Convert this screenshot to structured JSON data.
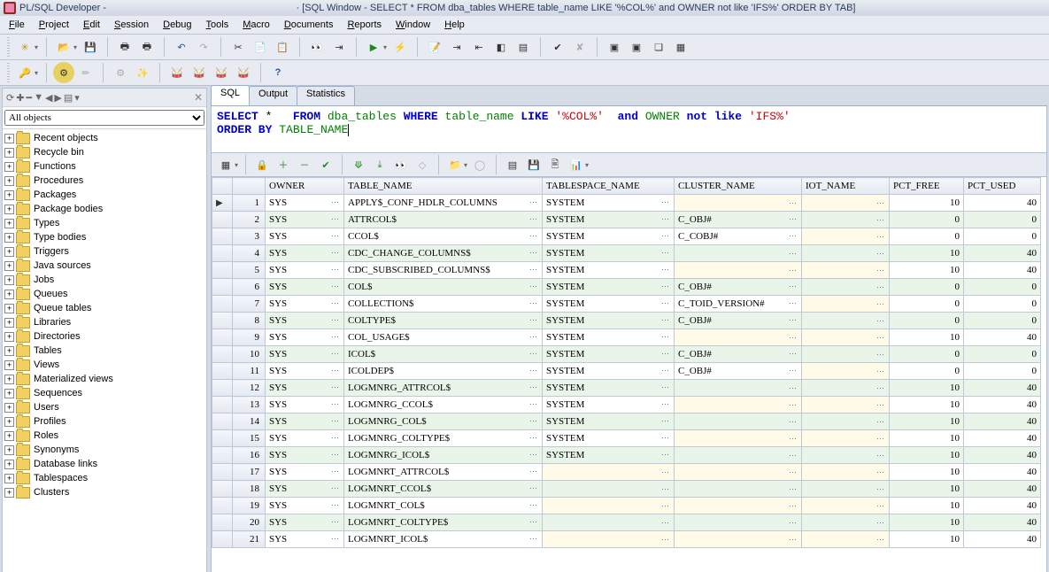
{
  "title": {
    "app": "PL/SQL Developer -",
    "doc": "· [SQL Window - SELECT * FROM dba_tables WHERE table_name LIKE '%COL%' and OWNER not like 'IFS%' ORDER BY TAB]"
  },
  "menu": [
    "File",
    "Project",
    "Edit",
    "Session",
    "Debug",
    "Tools",
    "Macro",
    "Documents",
    "Reports",
    "Window",
    "Help"
  ],
  "sidebar": {
    "filter_selected": "All objects",
    "items": [
      "Recent objects",
      "Recycle bin",
      "Functions",
      "Procedures",
      "Packages",
      "Package bodies",
      "Types",
      "Type bodies",
      "Triggers",
      "Java sources",
      "Jobs",
      "Queues",
      "Queue tables",
      "Libraries",
      "Directories",
      "Tables",
      "Views",
      "Materialized views",
      "Sequences",
      "Users",
      "Profiles",
      "Roles",
      "Synonyms",
      "Database links",
      "Tablespaces",
      "Clusters"
    ]
  },
  "editor": {
    "tabs": [
      "SQL",
      "Output",
      "Statistics"
    ],
    "active_tab": 0,
    "sql_line1": {
      "pre": "SELECT *   FROM ",
      "tbl": "dba_tables",
      "mid1": " WHERE ",
      "col": "table_name",
      "mid2": " LIKE ",
      "str1": "'%COL%'",
      "mid3": "  and ",
      "own": "OWNER",
      "mid4": " not like ",
      "str2": "'IFS%'"
    },
    "sql_line2": {
      "pre": "ORDER BY ",
      "col": "TABLE_NAME"
    }
  },
  "grid": {
    "columns": [
      "OWNER",
      "TABLE_NAME",
      "TABLESPACE_NAME",
      "CLUSTER_NAME",
      "IOT_NAME",
      "PCT_FREE",
      "PCT_USED"
    ],
    "rows": [
      {
        "n": 1,
        "cur": true,
        "owner": "SYS",
        "tname": "APPLY$_CONF_HDLR_COLUMNS",
        "ts": "SYSTEM",
        "cluster": "",
        "iot": "",
        "free": 10,
        "used": 40
      },
      {
        "n": 2,
        "owner": "SYS",
        "tname": "ATTRCOL$",
        "ts": "SYSTEM",
        "cluster": "C_OBJ#",
        "iot": "",
        "free": 0,
        "used": 0
      },
      {
        "n": 3,
        "owner": "SYS",
        "tname": "CCOL$",
        "ts": "SYSTEM",
        "cluster": "C_COBJ#",
        "iot": "",
        "free": 0,
        "used": 0
      },
      {
        "n": 4,
        "owner": "SYS",
        "tname": "CDC_CHANGE_COLUMNS$",
        "ts": "SYSTEM",
        "cluster": "",
        "iot": "",
        "free": 10,
        "used": 40
      },
      {
        "n": 5,
        "owner": "SYS",
        "tname": "CDC_SUBSCRIBED_COLUMNS$",
        "ts": "SYSTEM",
        "cluster": "",
        "iot": "",
        "free": 10,
        "used": 40
      },
      {
        "n": 6,
        "owner": "SYS",
        "tname": "COL$",
        "ts": "SYSTEM",
        "cluster": "C_OBJ#",
        "iot": "",
        "free": 0,
        "used": 0
      },
      {
        "n": 7,
        "owner": "SYS",
        "tname": "COLLECTION$",
        "ts": "SYSTEM",
        "cluster": "C_TOID_VERSION#",
        "iot": "",
        "free": 0,
        "used": 0
      },
      {
        "n": 8,
        "owner": "SYS",
        "tname": "COLTYPE$",
        "ts": "SYSTEM",
        "cluster": "C_OBJ#",
        "iot": "",
        "free": 0,
        "used": 0
      },
      {
        "n": 9,
        "owner": "SYS",
        "tname": "COL_USAGE$",
        "ts": "SYSTEM",
        "cluster": "",
        "iot": "",
        "free": 10,
        "used": 40
      },
      {
        "n": 10,
        "owner": "SYS",
        "tname": "ICOL$",
        "ts": "SYSTEM",
        "cluster": "C_OBJ#",
        "iot": "",
        "free": 0,
        "used": 0
      },
      {
        "n": 11,
        "owner": "SYS",
        "tname": "ICOLDEP$",
        "ts": "SYSTEM",
        "cluster": "C_OBJ#",
        "iot": "",
        "free": 0,
        "used": 0
      },
      {
        "n": 12,
        "owner": "SYS",
        "tname": "LOGMNRG_ATTRCOL$",
        "ts": "SYSTEM",
        "cluster": "",
        "iot": "",
        "free": 10,
        "used": 40
      },
      {
        "n": 13,
        "owner": "SYS",
        "tname": "LOGMNRG_CCOL$",
        "ts": "SYSTEM",
        "cluster": "",
        "iot": "",
        "free": 10,
        "used": 40
      },
      {
        "n": 14,
        "owner": "SYS",
        "tname": "LOGMNRG_COL$",
        "ts": "SYSTEM",
        "cluster": "",
        "iot": "",
        "free": 10,
        "used": 40
      },
      {
        "n": 15,
        "owner": "SYS",
        "tname": "LOGMNRG_COLTYPE$",
        "ts": "SYSTEM",
        "cluster": "",
        "iot": "",
        "free": 10,
        "used": 40
      },
      {
        "n": 16,
        "owner": "SYS",
        "tname": "LOGMNRG_ICOL$",
        "ts": "SYSTEM",
        "cluster": "",
        "iot": "",
        "free": 10,
        "used": 40
      },
      {
        "n": 17,
        "owner": "SYS",
        "tname": "LOGMNRT_ATTRCOL$",
        "ts": "",
        "cluster": "",
        "iot": "",
        "free": 10,
        "used": 40
      },
      {
        "n": 18,
        "owner": "SYS",
        "tname": "LOGMNRT_CCOL$",
        "ts": "",
        "cluster": "",
        "iot": "",
        "free": 10,
        "used": 40
      },
      {
        "n": 19,
        "owner": "SYS",
        "tname": "LOGMNRT_COL$",
        "ts": "",
        "cluster": "",
        "iot": "",
        "free": 10,
        "used": 40
      },
      {
        "n": 20,
        "owner": "SYS",
        "tname": "LOGMNRT_COLTYPE$",
        "ts": "",
        "cluster": "",
        "iot": "",
        "free": 10,
        "used": 40
      },
      {
        "n": 21,
        "owner": "SYS",
        "tname": "LOGMNRT_ICOL$",
        "ts": "",
        "cluster": "",
        "iot": "",
        "free": 10,
        "used": 40
      }
    ]
  }
}
